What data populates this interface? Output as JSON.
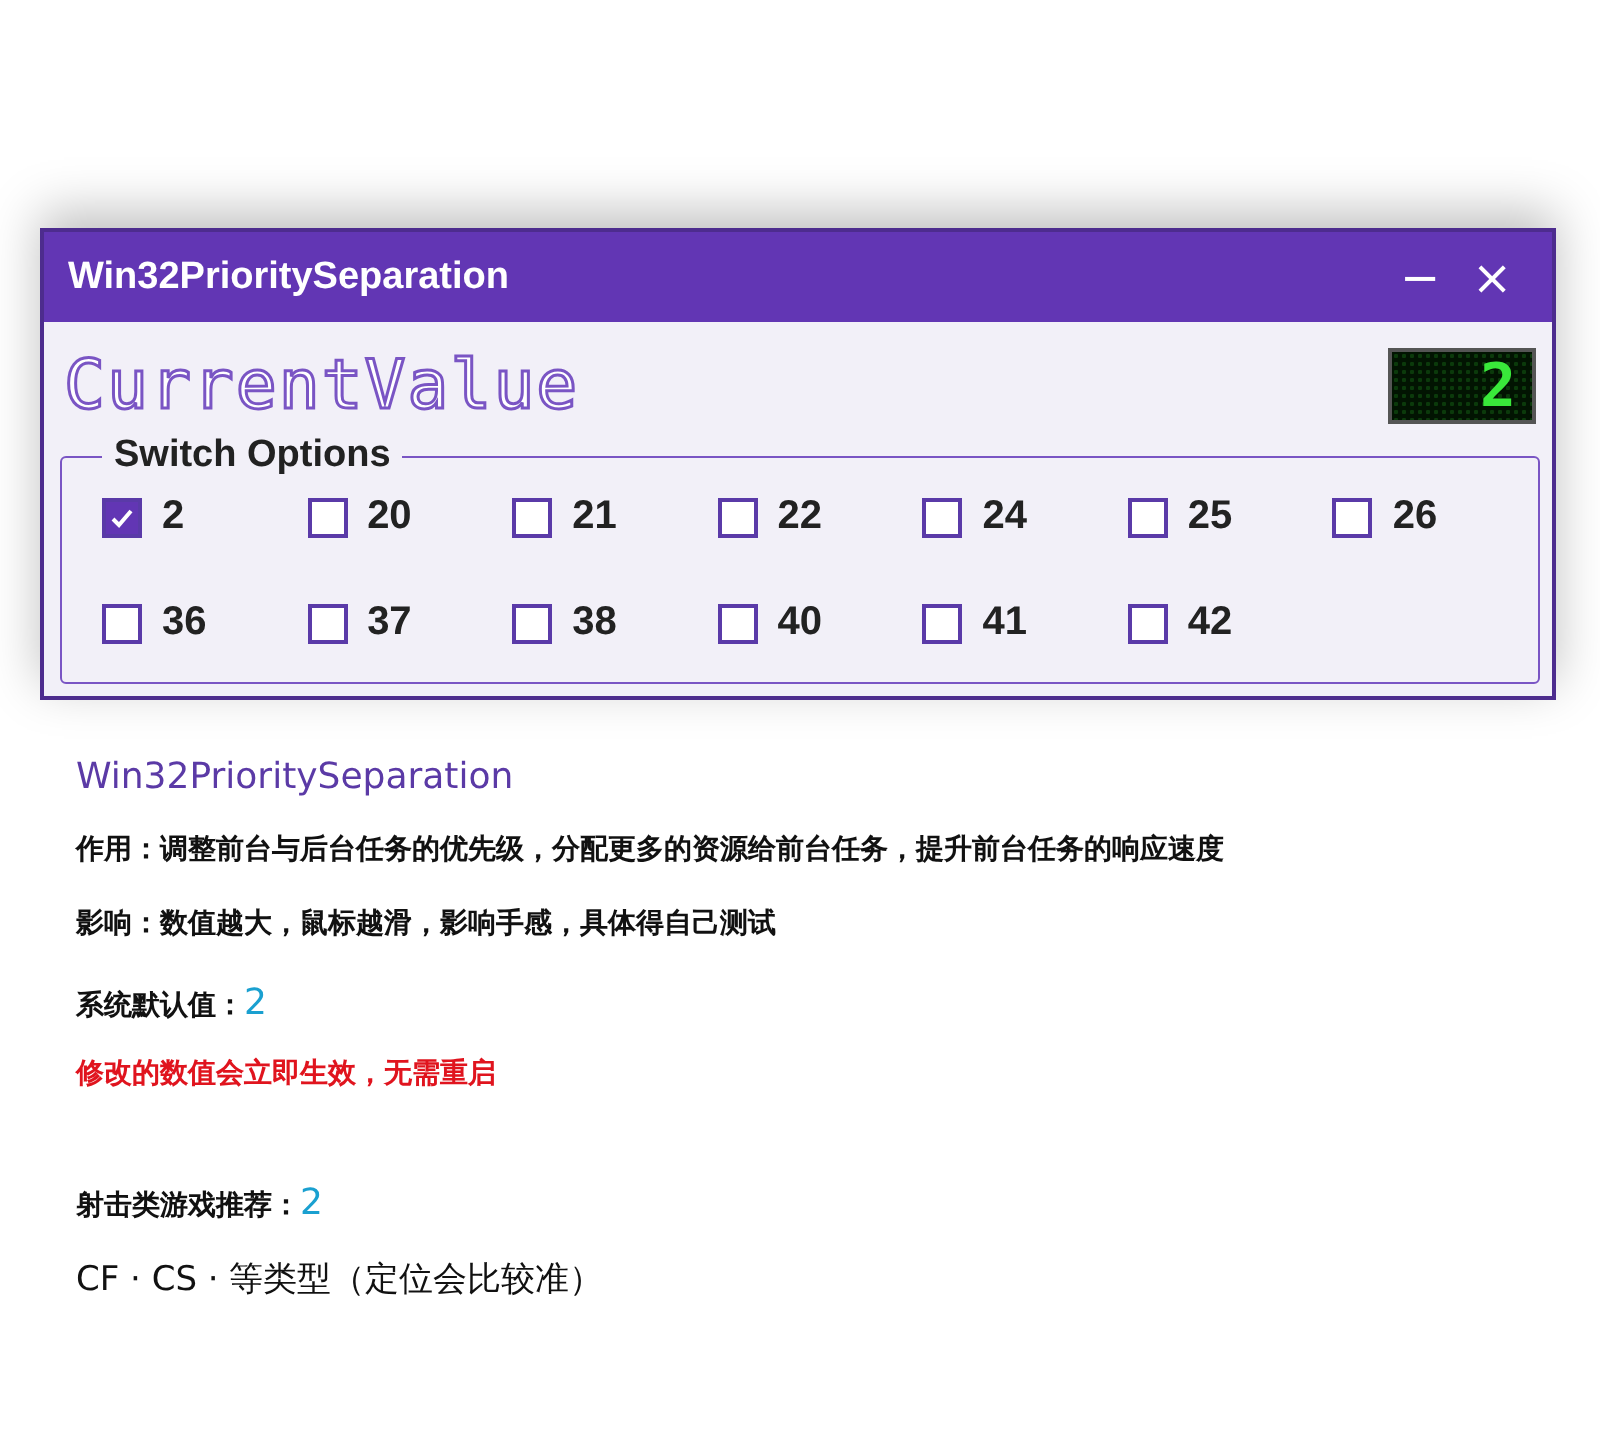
{
  "window": {
    "title": "Win32PrioritySeparation",
    "controls": [
      "−",
      "×"
    ]
  },
  "current_value": {
    "label": "CurrentValue",
    "display": "2"
  },
  "switch_options": {
    "label": "Switch Options",
    "options": [
      {
        "label": "2",
        "checked": true
      },
      {
        "label": "20",
        "checked": false
      },
      {
        "label": "21",
        "checked": false
      },
      {
        "label": "22",
        "checked": false
      },
      {
        "label": "24",
        "checked": false
      },
      {
        "label": "25",
        "checked": false
      },
      {
        "label": "26",
        "checked": false
      },
      {
        "label": "36",
        "checked": false
      },
      {
        "label": "37",
        "checked": false
      },
      {
        "label": "38",
        "checked": false
      },
      {
        "label": "40",
        "checked": false
      },
      {
        "label": "41",
        "checked": false
      },
      {
        "label": "42",
        "checked": false
      }
    ]
  },
  "notes": [
    {
      "kind": "heading",
      "text": "Win32PrioritySeparation"
    },
    {
      "kind": "plain",
      "text": "作用：调整前台与后台任务的优先级，分配更多的资源给前台任务，提升前台任务的响应速度"
    },
    {
      "kind": "plain",
      "text": "影响：数值越大，鼠标越滑，影响手感，具体得自己测试"
    },
    {
      "kind": "value",
      "text": "系统默认值：",
      "value": "2"
    },
    {
      "kind": "warning",
      "text": "修改的数值会立即生效，无需重启"
    },
    {
      "kind": "value",
      "text": "射击类游戏推荐：",
      "value": "2",
      "spaced": true
    },
    {
      "kind": "regular",
      "text": "CF · CS · 等类型（定位会比较准）"
    }
  ]
}
